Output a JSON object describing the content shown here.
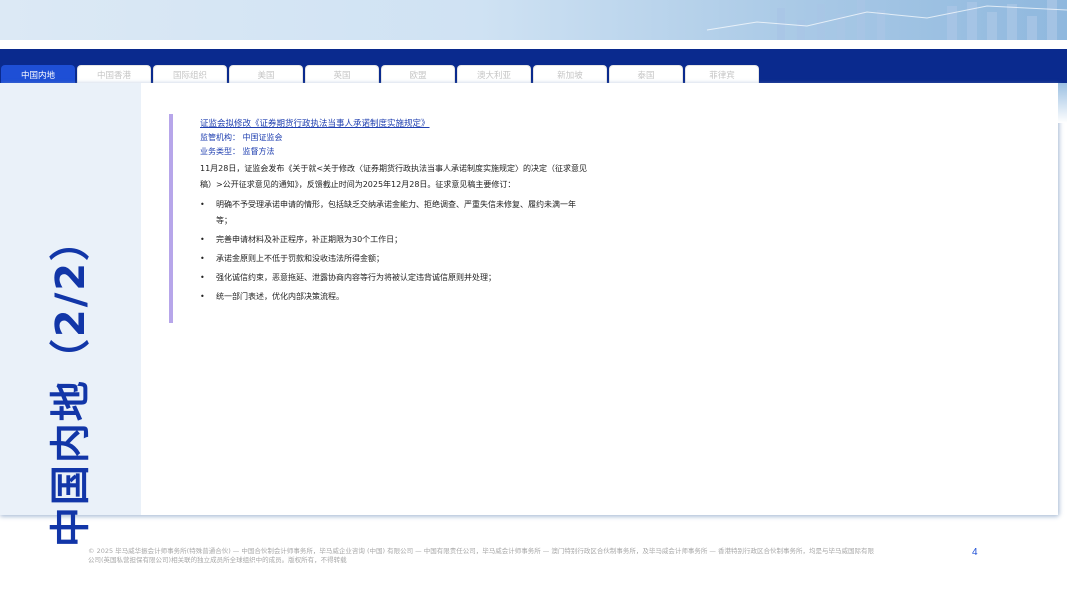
{
  "tabs": [
    {
      "label": "中国内地",
      "active": true
    },
    {
      "label": "中国香港",
      "active": false
    },
    {
      "label": "国际组织",
      "active": false
    },
    {
      "label": "美国",
      "active": false
    },
    {
      "label": "英国",
      "active": false
    },
    {
      "label": "欧盟",
      "active": false
    },
    {
      "label": "澳大利亚",
      "active": false
    },
    {
      "label": "新加坡",
      "active": false
    },
    {
      "label": "泰国",
      "active": false
    },
    {
      "label": "菲律宾",
      "active": false
    }
  ],
  "sidebar": {
    "title": "中国内地（2/2）"
  },
  "article": {
    "title": "证监会拟修改《证券期货行政执法当事人承诺制度实施规定》",
    "regulator": "监管机构： 中国证监会",
    "business_type": "业务类型： 监督方法",
    "body": "11月28日，证监会发布《关于就<关于修改〈证券期货行政执法当事人承诺制度实施规定〉的决定（征求意见稿）>公开征求意见的通知》，反馈截止时间为2025年12月28日。征求意见稿主要修订：",
    "bullet_glyph": "•",
    "points": [
      "明确不予受理承诺申请的情形，包括缺乏交纳承诺金能力、拒绝调查、严重失信未修复、履约未满一年等；",
      "完善申请材料及补正程序，补正期限为30个工作日；",
      "承诺金原则上不低于罚款和没收违法所得金额；",
      "强化诚信约束，恶意拖延、泄露协商内容等行为将被认定违背诚信原则并处理；",
      "统一部门表述，优化内部决策流程。"
    ]
  },
  "footer": {
    "text": "© 2025 毕马威华振会计师事务所(特殊普通合伙) — 中国合伙制会计师事务所，毕马威企业咨询 (中国) 有限公司 — 中国有限责任公司，毕马威会计师事务所 — 澳门特别行政区合伙制事务所，及毕马威会计师事务所 — 香港特别行政区合伙制事务所，均是与毕马威国际有限公司(英国私营担保有限公司)相关联的独立成员所全球组织中的成员。版权所有，不得转载",
    "page_number": "4"
  },
  "colors": {
    "navy": "#0a2a8e",
    "accent": "#1e4fd6",
    "sidebar_bg": "#eaf1f9",
    "quote_bar": "#b7a6ea"
  }
}
